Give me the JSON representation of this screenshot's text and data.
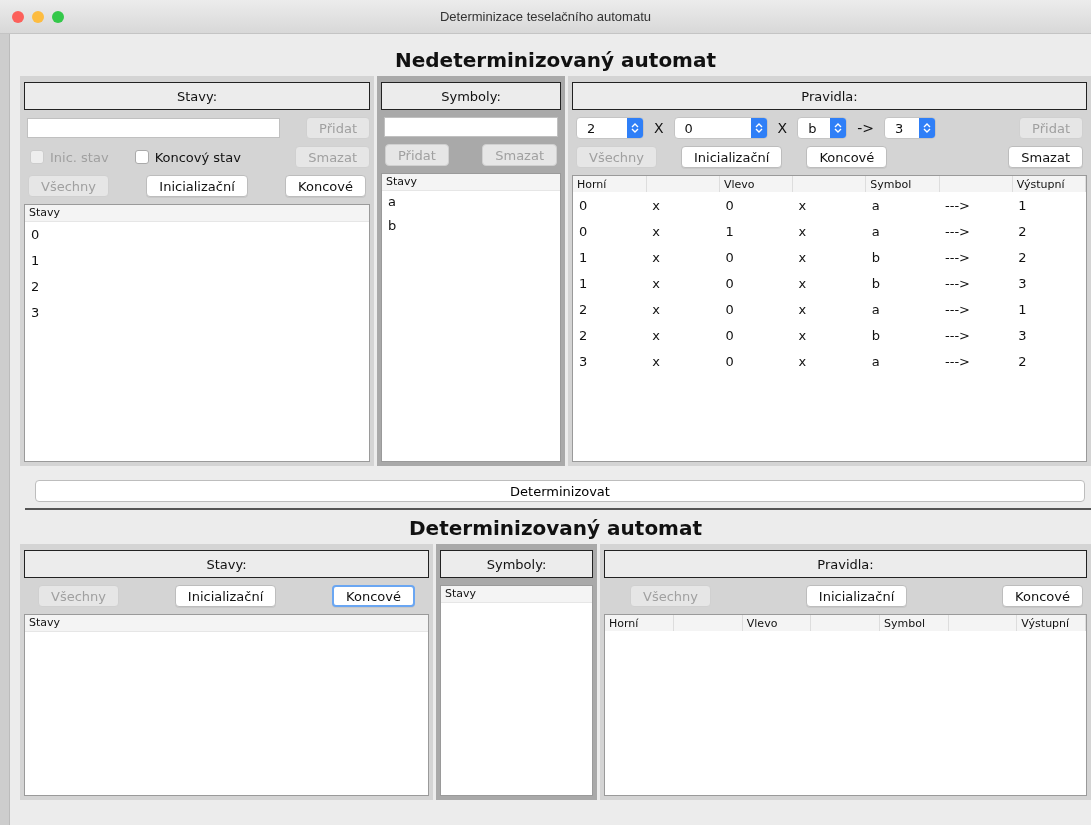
{
  "window": {
    "title": "Determinizace teselačního automatu"
  },
  "nondeterministic": {
    "heading": "Nedeterminizovaný automat",
    "states": {
      "title": "Stavy:",
      "add_button": {
        "label": "Přidat",
        "disabled": true
      },
      "checkboxes": [
        {
          "label": "Inic. stav",
          "checked": false,
          "disabled": true
        },
        {
          "label": "Koncový stav",
          "checked": false,
          "disabled": false
        }
      ],
      "delete_button": {
        "label": "Smazat",
        "disabled": true
      },
      "filters": [
        {
          "label": "Všechny",
          "disabled": true,
          "focused": false
        },
        {
          "label": "Inicializační",
          "disabled": false,
          "focused": false
        },
        {
          "label": "Koncové",
          "disabled": false,
          "focused": false
        }
      ],
      "list": {
        "header": "Stavy",
        "items": [
          "0",
          "1",
          "2",
          "3"
        ]
      }
    },
    "symbols": {
      "title": "Symboly:",
      "buttons": [
        {
          "label": "Přidat",
          "disabled": true
        },
        {
          "label": "Smazat",
          "disabled": true
        }
      ],
      "list": {
        "header": "Stavy",
        "items": [
          "a",
          "b"
        ]
      }
    },
    "rules": {
      "title": "Pravidla:",
      "selectors": [
        {
          "kind": "spinner",
          "value": "2"
        },
        {
          "kind": "separator",
          "text": "X"
        },
        {
          "kind": "spinner",
          "value": "0"
        },
        {
          "kind": "separator",
          "text": "X"
        },
        {
          "kind": "spinner",
          "value": "b"
        },
        {
          "kind": "separator",
          "text": "->"
        },
        {
          "kind": "spinner",
          "value": "3"
        }
      ],
      "add_button": {
        "label": "Přidat",
        "disabled": true
      },
      "filters": [
        {
          "label": "Všechny",
          "disabled": true,
          "focused": false
        },
        {
          "label": "Inicializační",
          "disabled": false,
          "focused": false
        },
        {
          "label": "Koncové",
          "disabled": false,
          "focused": false
        }
      ],
      "delete_button": {
        "label": "Smazat",
        "disabled": false
      },
      "table": {
        "columns": [
          {
            "label": "Horní"
          },
          {},
          {
            "label": "Vlevo"
          },
          {},
          {
            "label": "Symbol"
          },
          {},
          {
            "label": "Výstupní"
          }
        ],
        "rows": [
          [
            "0",
            "x",
            "0",
            "x",
            "a",
            "--->",
            "1"
          ],
          [
            "0",
            "x",
            "1",
            "x",
            "a",
            "--->",
            "2"
          ],
          [
            "1",
            "x",
            "0",
            "x",
            "b",
            "--->",
            "2"
          ],
          [
            "1",
            "x",
            "0",
            "x",
            "b",
            "--->",
            "3"
          ],
          [
            "2",
            "x",
            "0",
            "x",
            "a",
            "--->",
            "1"
          ],
          [
            "2",
            "x",
            "0",
            "x",
            "b",
            "--->",
            "3"
          ],
          [
            "3",
            "x",
            "0",
            "x",
            "a",
            "--->",
            "2"
          ]
        ]
      }
    }
  },
  "determinize_button": {
    "label": "Determinizovat"
  },
  "deterministic": {
    "heading": "Determinizovaný automat",
    "states": {
      "title": "Stavy:",
      "filters": [
        {
          "label": "Všechny",
          "disabled": true,
          "focused": false
        },
        {
          "label": "Inicializační",
          "disabled": false,
          "focused": false
        },
        {
          "label": "Koncové",
          "disabled": false,
          "focused": true
        }
      ],
      "list": {
        "header": "Stavy"
      }
    },
    "symbols": {
      "title": "Symboly:",
      "list": {
        "header": "Stavy"
      }
    },
    "rules": {
      "title": "Pravidla:",
      "filters": [
        {
          "label": "Všechny",
          "disabled": true,
          "focused": false
        },
        {
          "label": "Inicializační",
          "disabled": false,
          "focused": false
        },
        {
          "label": "Koncové",
          "disabled": false,
          "focused": false
        }
      ],
      "table": {
        "columns": [
          {
            "label": "Horní"
          },
          {},
          {
            "label": "Vlevo"
          },
          {},
          {
            "label": "Symbol"
          },
          {},
          {
            "label": "Výstupní"
          }
        ]
      }
    }
  }
}
